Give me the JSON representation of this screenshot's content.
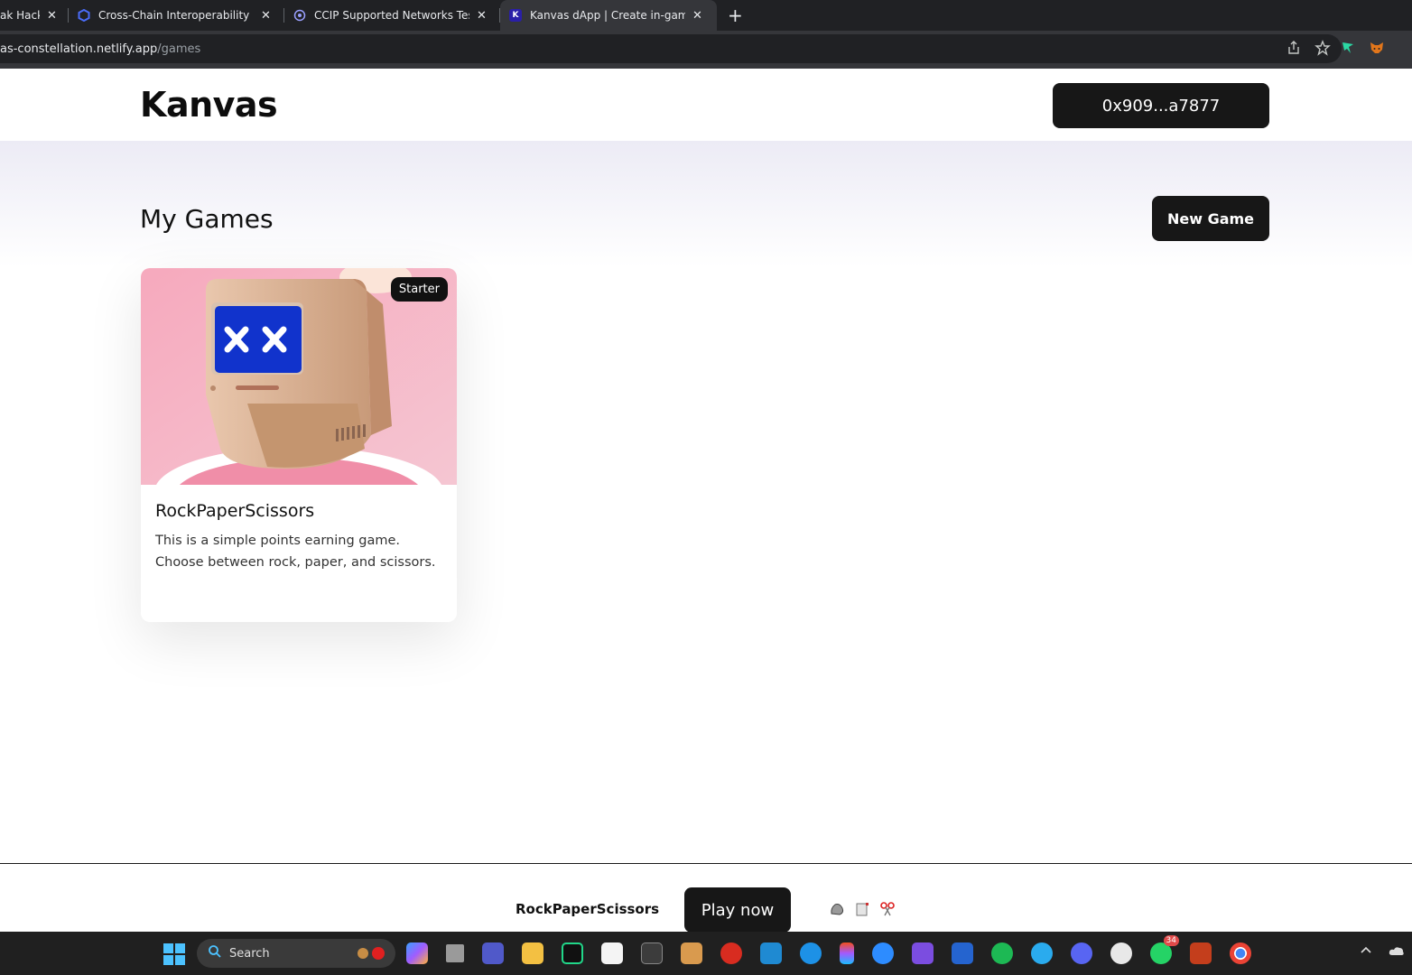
{
  "browser": {
    "tabs": [
      {
        "title": "ak Hacka",
        "close": "✕"
      },
      {
        "title": "Cross-Chain Interoperability Pro",
        "close": "✕"
      },
      {
        "title": "CCIP Supported Networks Testn",
        "close": "✕"
      },
      {
        "title": "Kanvas dApp | Create in-game D",
        "close": "✕",
        "favicon_letter": "K"
      }
    ],
    "new_tab": "+",
    "url_host": "as-constellation.netlify.app",
    "url_path": "/games"
  },
  "header": {
    "logo": "Kanvas",
    "wallet_address": "0x909...a7877"
  },
  "games": {
    "title": "My Games",
    "new_game_label": "New Game",
    "cards": [
      {
        "badge": "Starter",
        "title": "RockPaperScissors",
        "description": "This is a simple points earning game. Choose between rock, paper, and scissors."
      }
    ]
  },
  "footer": {
    "game_name": "RockPaperScissors",
    "play_label": "Play now",
    "icons": [
      "rock-icon",
      "paper-icon",
      "scissors-icon"
    ]
  },
  "taskbar": {
    "search_label": "Search",
    "whatsapp_badge": "34"
  },
  "colors": {
    "button_bg": "#171717",
    "card_image_bg": "#f2b8c6",
    "screen_blue": "#1133cc"
  }
}
